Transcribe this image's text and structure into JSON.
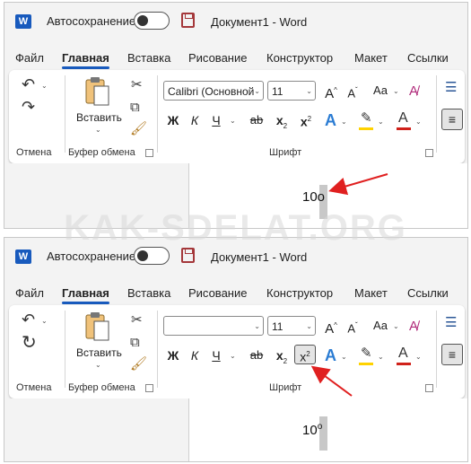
{
  "watermark": "KAK-SDELAT.ORG",
  "colors": {
    "word_blue": "#185abd",
    "arrow_red": "#e02020",
    "highlight_yellow": "#ffd200",
    "font_red": "#d0211a"
  },
  "panels": [
    {
      "title": {
        "autosave_label": "Автосохранение",
        "document": "Документ1 - Word",
        "logo": "W"
      },
      "tabs": [
        "Файл",
        "Главная",
        "Вставка",
        "Рисование",
        "Конструктор",
        "Макет",
        "Ссылки"
      ],
      "active_tab": "Главная",
      "ribbon": {
        "undo_group": "Отмена",
        "clipboard_group": "Буфер обмена",
        "paste_label": "Вставить",
        "font_group": "Шрифт",
        "font_name": "Calibri (Основной",
        "font_size": "11",
        "bold": "Ж",
        "italic": "К",
        "underline": "Ч",
        "strike": "ab",
        "subscript": "x",
        "superscript": "x",
        "superscript_active": false,
        "grow": "A",
        "shrink": "A",
        "case": "Aa"
      },
      "document_text": "10o",
      "arrow_target": "document-text"
    },
    {
      "title": {
        "autosave_label": "Автосохранение",
        "document": "Документ1 - Word",
        "logo": "W"
      },
      "tabs": [
        "Файл",
        "Главная",
        "Вставка",
        "Рисование",
        "Конструктор",
        "Макет",
        "Ссылки"
      ],
      "active_tab": "Главная",
      "ribbon": {
        "undo_group": "Отмена",
        "clipboard_group": "Буфер обмена",
        "paste_label": "Вставить",
        "font_group": "Шрифт",
        "font_name": "",
        "font_size": "11",
        "bold": "Ж",
        "italic": "К",
        "underline": "Ч",
        "strike": "ab",
        "subscript": "x",
        "superscript": "x",
        "superscript_active": true,
        "grow": "A",
        "shrink": "A",
        "case": "Aa"
      },
      "document_text": "10",
      "document_sup": "o",
      "arrow_target": "superscript-button"
    }
  ]
}
